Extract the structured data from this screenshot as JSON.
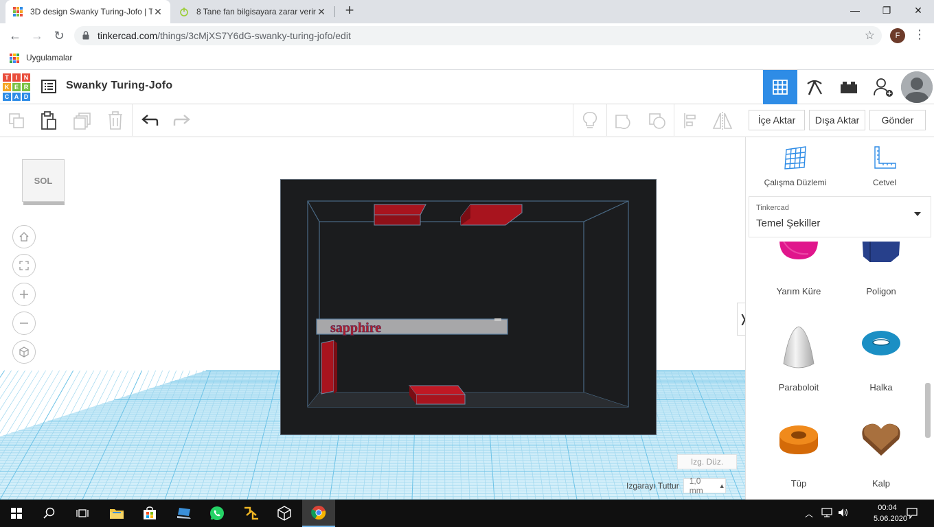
{
  "browser": {
    "tabs": [
      {
        "title": "3D design Swanky Turing-Jofo | T",
        "active": true
      },
      {
        "title": "8 Tane fan bilgisayara zarar verir",
        "active": false
      }
    ],
    "url_host": "tinkercad.com",
    "url_path": "/things/3cMjXS7Y6dG-swanky-turing-jofo/edit",
    "bookmarks_label": "Uygulamalar",
    "profile_initial": "F"
  },
  "app": {
    "logo_letters": [
      "T",
      "I",
      "N",
      "K",
      "E",
      "R",
      "C",
      "A",
      "D"
    ],
    "design_title": "Swanky Turing-Jofo",
    "header_buttons": [
      "3d-design-view-icon",
      "codeblocks-pickaxe-icon",
      "bricks-icon",
      "add-user-icon"
    ]
  },
  "toolbar": {
    "import_label": "İçe Aktar",
    "export_label": "Dışa Aktar",
    "send_label": "Gönder"
  },
  "workplane": {
    "view_cube_label": "SOL",
    "edit_grid_label": "Izg. Düz.",
    "snap_label": "Izgarayı Tuttur",
    "snap_value": "1,0 mm",
    "scene_text": "sapphire"
  },
  "panel": {
    "workplane_label": "Çalışma Düzlemi",
    "ruler_label": "Cetvel",
    "library_source": "Tinkercad",
    "library_name": "Temel Şekiller",
    "shapes": [
      {
        "label": "Yarım Küre",
        "color": "#e0168c"
      },
      {
        "label": "Poligon",
        "color": "#27408b"
      },
      {
        "label": "Paraboloit",
        "color": "#d8d8d8"
      },
      {
        "label": "Halka",
        "color": "#1b8fc4"
      },
      {
        "label": "Tüp",
        "color": "#e8760e"
      },
      {
        "label": "Kalp",
        "color": "#8c5a32"
      }
    ]
  },
  "taskbar": {
    "time": "00:04",
    "date": "5.06.2020"
  },
  "colors": {
    "accent": "#2e8ce6",
    "scene_bg": "#1b1c1e",
    "part_red": "#a8141e",
    "grid_blue": "#8fd3f0"
  }
}
